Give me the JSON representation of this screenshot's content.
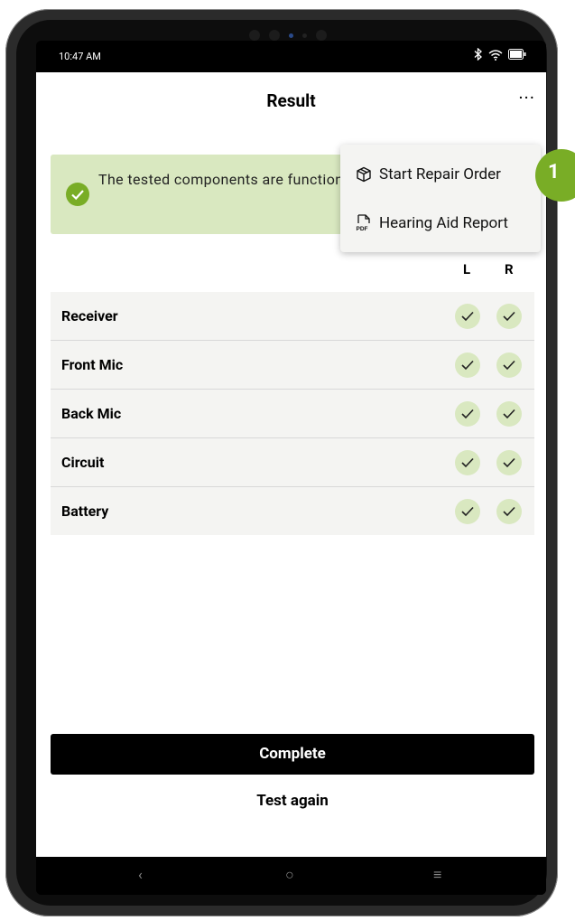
{
  "status": {
    "time": "10:47 AM"
  },
  "header": {
    "title": "Result",
    "more_label": "···"
  },
  "banner": {
    "text": "The tested components are functioning as expected."
  },
  "columns": {
    "left": "L",
    "right": "R"
  },
  "components": [
    {
      "name": "Receiver",
      "left": "ok",
      "right": "ok"
    },
    {
      "name": "Front Mic",
      "left": "ok",
      "right": "ok"
    },
    {
      "name": "Back Mic",
      "left": "ok",
      "right": "ok"
    },
    {
      "name": "Circuit",
      "left": "ok",
      "right": "ok"
    },
    {
      "name": "Battery",
      "left": "ok",
      "right": "ok"
    }
  ],
  "menu": {
    "items": [
      {
        "label": "Start Repair Order",
        "icon": "package-icon"
      },
      {
        "label": "Hearing Aid Report",
        "icon": "pdf-icon"
      }
    ]
  },
  "actions": {
    "complete": "Complete",
    "test_again": "Test again"
  },
  "annotation": {
    "badge": "1"
  },
  "colors": {
    "accent": "#79ad26",
    "banner_bg": "#d9e8c0"
  }
}
